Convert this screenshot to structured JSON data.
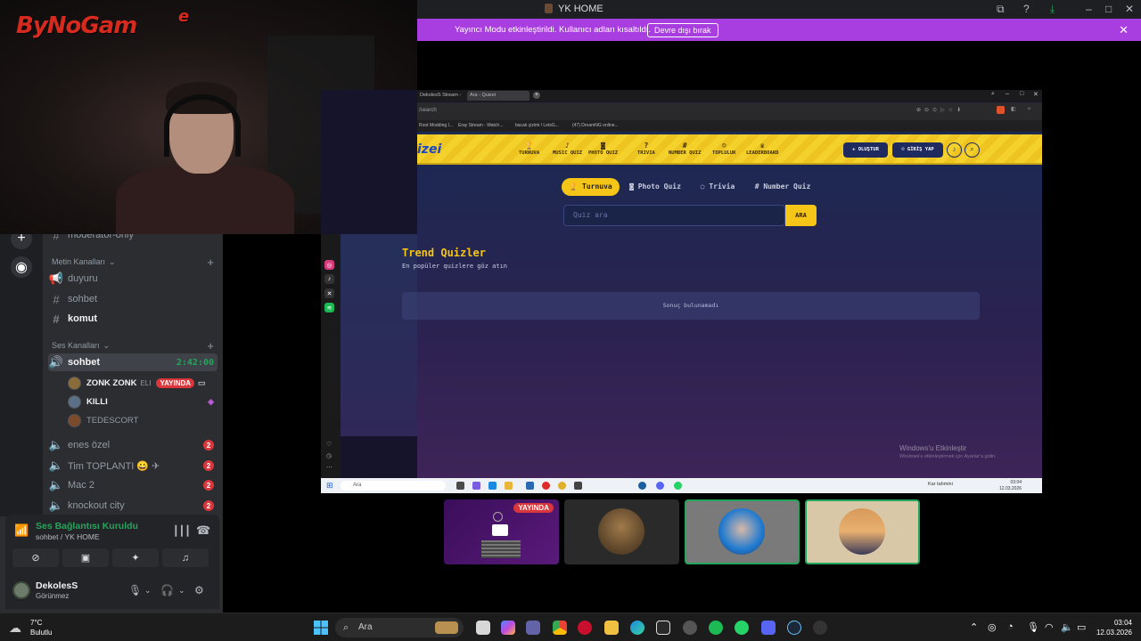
{
  "window": {
    "title": "YK HOME"
  },
  "streamer_notice": {
    "text": "Yayıncı Modu etkinleştirildi. Kullanıcı adları kısaltıldı.",
    "button": "Devre dışı bırak"
  },
  "webcam": {
    "logo_text": "ByNoGam",
    "logo_extra": "e"
  },
  "discord": {
    "channels_partial": "moderatör-only",
    "text_category": "Metin Kanalları",
    "text_channels": [
      "duyuru",
      "sohbet",
      "komut"
    ],
    "voice_category": "Ses Kanalları",
    "active_voice": {
      "name": "sohbet",
      "timer": "2:42:00"
    },
    "members": [
      {
        "name": "ZONK ZONK",
        "tag": "ELI",
        "live": "YAYINDA"
      },
      {
        "name": "KILLI"
      },
      {
        "name": "TEDESCORT"
      }
    ],
    "other_voice": [
      {
        "name": "enes özel",
        "badge": "2"
      },
      {
        "name": "Tim TOPLANTI 😀 ✈",
        "badge": "2"
      },
      {
        "name": "Mac 2",
        "badge": "2"
      },
      {
        "name": "knockout city",
        "badge": "2"
      }
    ],
    "voice_status": {
      "title": "Ses Bağlantısı Kuruldu",
      "subtitle": "sohbet / YK HOME"
    },
    "user": {
      "name": "DekolesS",
      "status": "Görünmez"
    }
  },
  "browser": {
    "tabs": [
      "DekolesS Stream - Watch...",
      "Ara - Quizei"
    ],
    "url": "/search",
    "bookmarks": [
      "Root Modding I...",
      "Eray Stream - Watch...",
      "bacak çizimi / LetsG...",
      "(47) DreamNG online..."
    ]
  },
  "site": {
    "logo": "izei",
    "nav": [
      "TURNUVA",
      "MUSIC QUIZ",
      "PHOTO QUIZ",
      "TRIVIA",
      "NUMBER QUIZ",
      "TOPLULUK",
      "LEADERBOARD"
    ],
    "create_btn": "+ OLUŞTUR",
    "login_btn": "GİRİŞ YAP",
    "filters": [
      "Turnuva",
      "Photo Quiz",
      "Trivia",
      "Number Quiz"
    ],
    "search_placeholder": "Quiz ara",
    "search_btn": "ARA",
    "trend_title": "Trend Quizler",
    "trend_sub": "En popüler quizlere göz atın",
    "empty_text": "Sonuç bulunamadı",
    "watermark_title": "Windows'u Etkinleştir",
    "watermark_sub": "Windows'u etkinleştirmek için Ayarlar'a gidin."
  },
  "inner_taskbar": {
    "search": "Ara",
    "weather": "Kar tahmini",
    "time": "03:04",
    "date": "12.03.2026"
  },
  "participants": {
    "live_badge": "YAYINDA"
  },
  "taskbar": {
    "temp": "7°C",
    "weather": "Bulutlu",
    "search": "Ara",
    "time": "03:04",
    "date": "12.03.2026"
  },
  "colors": {
    "discord_bg": "#2b2d31",
    "green": "#23a55a",
    "notice_purple": "#a93ee0",
    "site_yellow": "#f5c518",
    "live_red": "#da373c"
  }
}
